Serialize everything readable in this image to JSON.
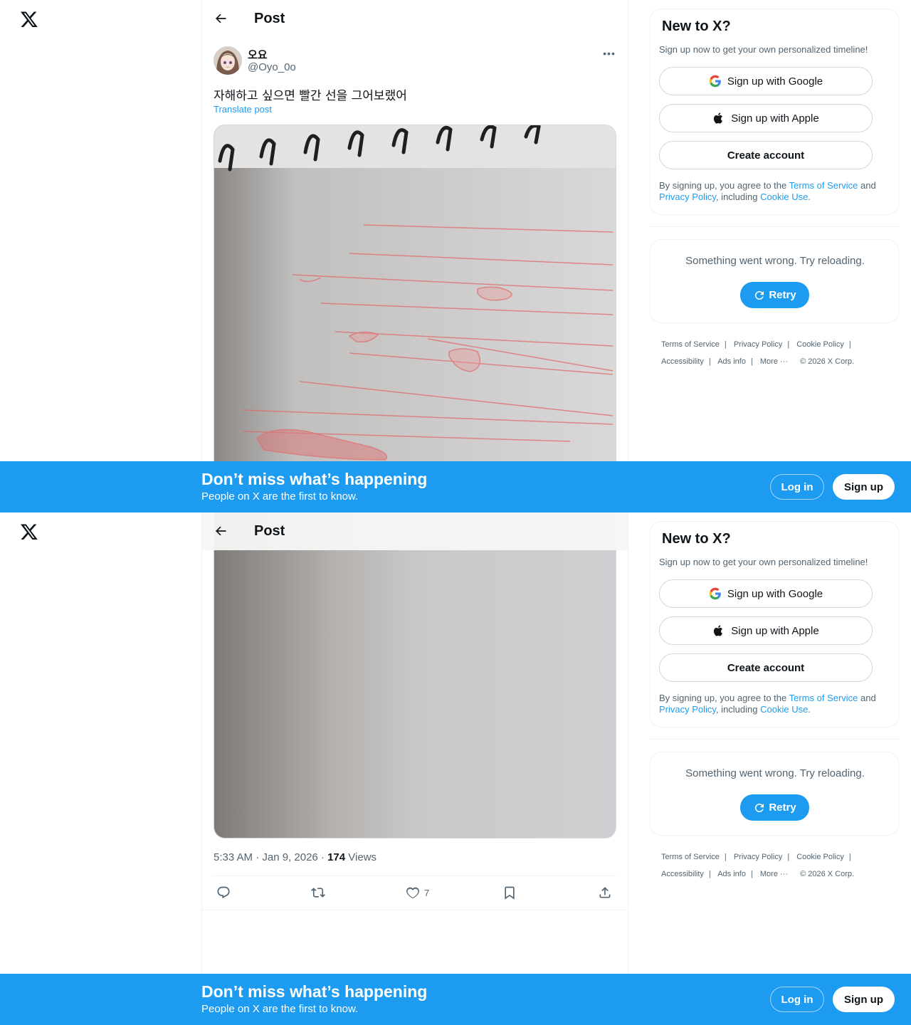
{
  "header": {
    "title": "Post"
  },
  "post": {
    "display_name": "오요",
    "handle": "@Oyo_0o",
    "text": "자해하고 싶으면 빨간 선을 그어보랬어",
    "translate_label": "Translate post",
    "time": "5:33 AM · Jan 9, 2026 · ",
    "views_count": "174",
    "views_label": " Views",
    "likes": "7"
  },
  "signup_card": {
    "title": "New to X?",
    "subtitle": "Sign up now to get your own personalized timeline!",
    "google_label": "Sign up with Google",
    "apple_label": "Sign up with Apple",
    "create_label": "Create account",
    "legal_prefix": "By signing up, you agree to the ",
    "terms": "Terms of Service",
    "and": " and",
    "privacy": "Privacy Policy",
    "including": ", including ",
    "cookie": "Cookie Use."
  },
  "error_card": {
    "message": "Something went wrong. Try reloading.",
    "retry_label": "Retry"
  },
  "footer": {
    "terms": "Terms of Service",
    "privacy": "Privacy Policy",
    "cookie": "Cookie Policy",
    "accessibility": "Accessibility",
    "ads": "Ads info",
    "more": "More ···",
    "copyright": "© 2026 X Corp."
  },
  "banner": {
    "title": "Don’t miss what’s happening",
    "subtitle": "People on X are the first to know.",
    "login_label": "Log in",
    "signup_label": "Sign up"
  },
  "colors": {
    "accent": "#1d9bf0",
    "text": "#0f1419",
    "muted": "#536471",
    "border": "#eff3f4"
  }
}
